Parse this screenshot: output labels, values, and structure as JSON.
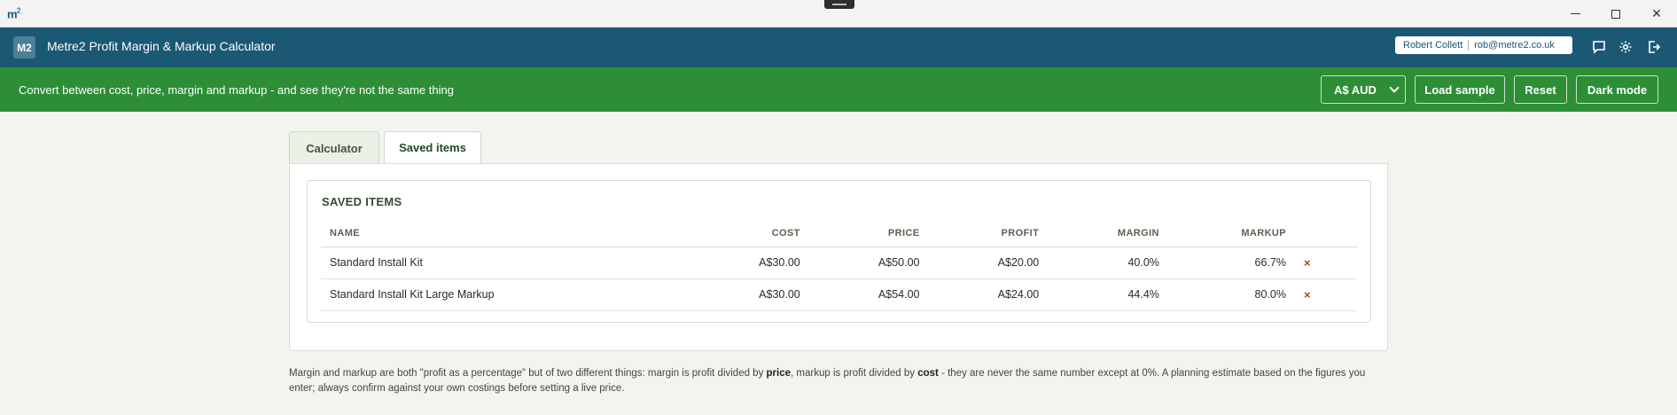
{
  "chrome": {
    "app_mark": "m",
    "app_mark_sup": "2"
  },
  "header": {
    "logo": "M2",
    "title": "Metre2 Profit Margin & Markup Calculator",
    "user_name": "Robert Collett",
    "user_email": "rob@metre2.co.uk",
    "icons": [
      "feedback-icon",
      "settings-icon",
      "logout-icon"
    ]
  },
  "toolbar": {
    "tagline": "Convert between cost, price, margin and markup - and see they're not the same thing",
    "currency": "A$ AUD",
    "load_sample": "Load sample",
    "reset": "Reset",
    "dark_mode": "Dark mode"
  },
  "tabs": {
    "calculator": "Calculator",
    "saved": "Saved items"
  },
  "saved_items": {
    "title": "SAVED ITEMS",
    "columns": [
      "NAME",
      "COST",
      "PRICE",
      "PROFIT",
      "MARGIN",
      "MARKUP"
    ],
    "rows": [
      {
        "name": "Standard Install Kit",
        "cost": "A$30.00",
        "price": "A$50.00",
        "profit": "A$20.00",
        "margin": "40.0%",
        "markup": "66.7%",
        "delete": "×"
      },
      {
        "name": "Standard Install Kit Large Markup",
        "cost": "A$30.00",
        "price": "A$54.00",
        "profit": "A$24.00",
        "margin": "44.4%",
        "markup": "80.0%",
        "delete": "×"
      }
    ]
  },
  "footnote": {
    "part1": "Margin and markup are both \"profit as a percentage\" but of two different things: margin is profit divided by ",
    "bold1": "price",
    "part2": ", markup is profit divided by ",
    "bold2": "cost",
    "part3": " - they are never the same number except at 0%. A planning estimate based on the figures you enter; always confirm against your own costings before setting a live price."
  },
  "colors": {
    "header_bg": "#1b5874",
    "toolbar_bg": "#2d8e36",
    "delete": "#c0392b"
  }
}
